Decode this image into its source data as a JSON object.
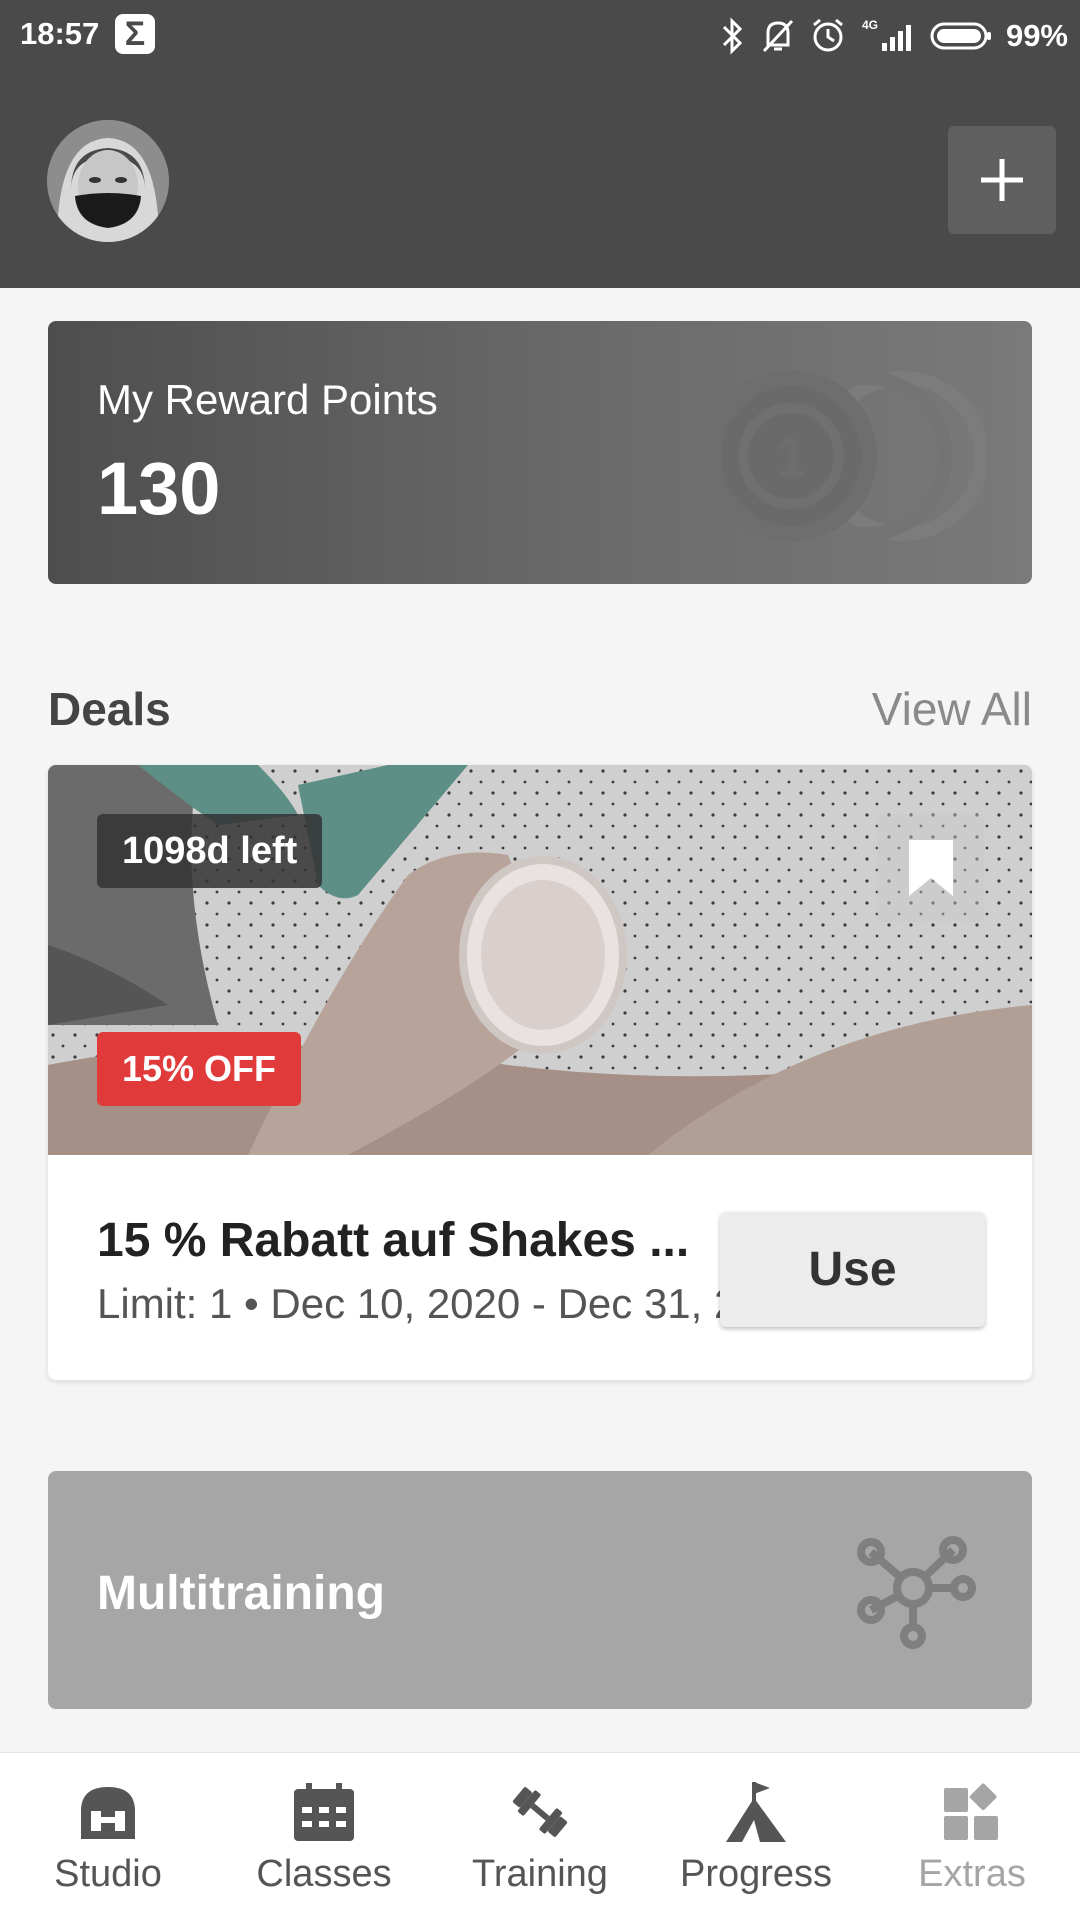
{
  "status_bar": {
    "time": "18:57",
    "battery": "99%",
    "network": "4G",
    "icons": [
      "sigma-icon",
      "bluetooth-icon",
      "silent-icon",
      "alarm-icon",
      "signal-icon",
      "battery-icon"
    ]
  },
  "header": {
    "avatar": "user-avatar",
    "add_icon": "plus-icon"
  },
  "rewards": {
    "title": "My Reward Points",
    "points": "130",
    "icon": "coins-icon",
    "coin_label": "1"
  },
  "deals": {
    "title": "Deals",
    "view_all": "View All",
    "items": [
      {
        "time_left": "1098d left",
        "discount": "15% OFF",
        "title": "15 % Rabatt auf Shakes ...",
        "meta": "Limit: 1 • Dec 10, 2020 - Dec 31, 2",
        "action": "Use",
        "icon": "bookmark-icon"
      }
    ]
  },
  "multitraining": {
    "label": "Multitraining",
    "icon": "network-icon"
  },
  "nav": {
    "items": [
      {
        "label": "Studio",
        "icon": "studio-icon"
      },
      {
        "label": "Classes",
        "icon": "calendar-icon"
      },
      {
        "label": "Training",
        "icon": "dumbbell-icon"
      },
      {
        "label": "Progress",
        "icon": "mountain-flag-icon"
      },
      {
        "label": "Extras",
        "icon": "grid-icon"
      }
    ]
  },
  "colors": {
    "header_bg": "#4a4a4a",
    "discount_badge": "#e03a3a",
    "page_bg": "#f5f5f5",
    "multi_card": "#a6a6a6"
  }
}
